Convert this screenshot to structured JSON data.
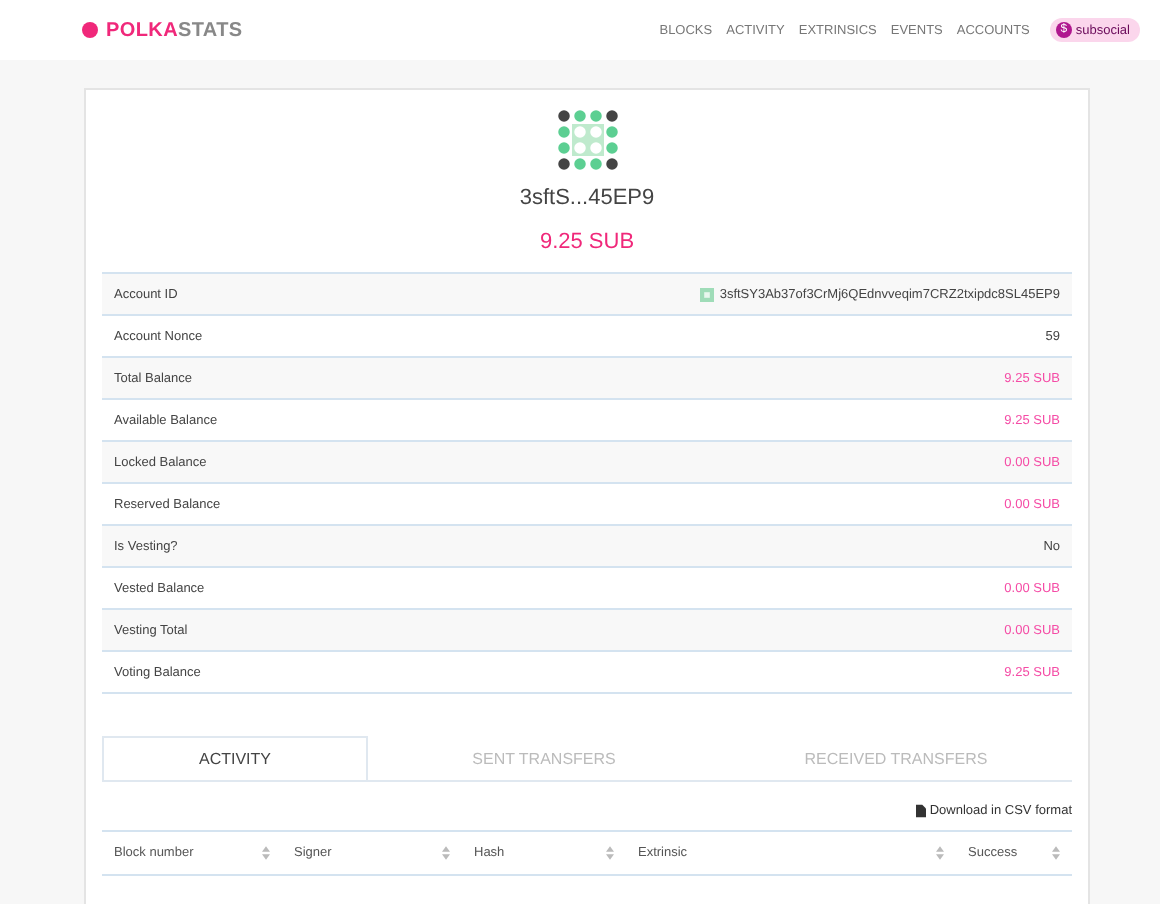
{
  "header": {
    "logo": {
      "first": "POLKA",
      "second": "STATS"
    },
    "nav": [
      "BLOCKS",
      "ACTIVITY",
      "EXTRINSICS",
      "EVENTS",
      "ACCOUNTS"
    ],
    "network": {
      "icon": "$",
      "label": "subsocial"
    }
  },
  "account": {
    "short_address": "3sftS...45EP9",
    "balance": "9.25 SUB"
  },
  "details": [
    {
      "label": "Account ID",
      "value": "3sftSY3Ab37of3CrMj6QEdnvveqim7CRZ2txipdc8SL45EP9",
      "kind": "address"
    },
    {
      "label": "Account Nonce",
      "value": "59",
      "kind": "text"
    },
    {
      "label": "Total Balance",
      "value": "9.25 SUB",
      "kind": "amount"
    },
    {
      "label": "Available Balance",
      "value": "9.25 SUB",
      "kind": "amount"
    },
    {
      "label": "Locked Balance",
      "value": "0.00 SUB",
      "kind": "amount"
    },
    {
      "label": "Reserved Balance",
      "value": "0.00 SUB",
      "kind": "amount"
    },
    {
      "label": "Is Vesting?",
      "value": "No",
      "kind": "text"
    },
    {
      "label": "Vested Balance",
      "value": "0.00 SUB",
      "kind": "amount"
    },
    {
      "label": "Vesting Total",
      "value": "0.00 SUB",
      "kind": "amount"
    },
    {
      "label": "Voting Balance",
      "value": "9.25 SUB",
      "kind": "amount"
    }
  ],
  "tabs": [
    {
      "label": "ACTIVITY",
      "selected": true
    },
    {
      "label": "SENT TRANSFERS",
      "selected": false
    },
    {
      "label": "RECEIVED TRANSFERS",
      "selected": false
    }
  ],
  "download": "Download in CSV format",
  "table": {
    "columns": [
      "Block number",
      "Signer",
      "Hash",
      "Extrinsic",
      "Success"
    ]
  }
}
